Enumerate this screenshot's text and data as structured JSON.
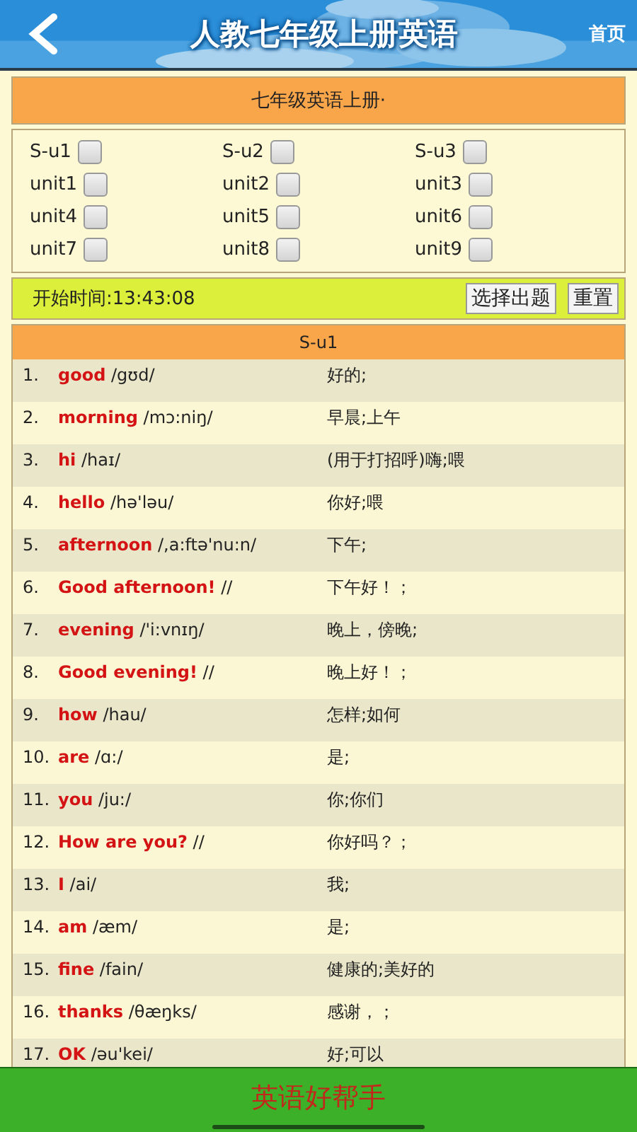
{
  "header": {
    "title": "人教七年级上册英语",
    "home_link": "首页"
  },
  "book_title": "七年级英语上册·",
  "units": [
    {
      "label": "S-u1",
      "checked": false
    },
    {
      "label": "S-u2",
      "checked": false
    },
    {
      "label": "S-u3",
      "checked": false
    },
    {
      "label": "unit1",
      "checked": false
    },
    {
      "label": "unit2",
      "checked": false
    },
    {
      "label": "unit3",
      "checked": false
    },
    {
      "label": "unit4",
      "checked": false
    },
    {
      "label": "unit5",
      "checked": false
    },
    {
      "label": "unit6",
      "checked": false
    },
    {
      "label": "unit7",
      "checked": false
    },
    {
      "label": "unit8",
      "checked": false
    },
    {
      "label": "unit9",
      "checked": false
    }
  ],
  "control_bar": {
    "start_time": "开始时间:13:43:08",
    "buttons": [
      "选择出题",
      "重置"
    ]
  },
  "word_list": {
    "title": "S-u1",
    "rows": [
      {
        "number": "1.",
        "word": "good",
        "phonetic": "/gʊd/",
        "meaning": "好的;"
      },
      {
        "number": "2.",
        "word": "morning",
        "phonetic": "/mɔ:niŋ/",
        "meaning": "早晨;上午"
      },
      {
        "number": "3.",
        "word": "hi",
        "phonetic": "/haɪ/",
        "meaning": "(用于打招呼)嗨;喂"
      },
      {
        "number": "4.",
        "word": "hello",
        "phonetic": "/hə'ləu/",
        "meaning": "你好;喂"
      },
      {
        "number": "5.",
        "word": "afternoon",
        "phonetic": "/,a:ftə'nu:n/",
        "meaning": "下午;"
      },
      {
        "number": "6.",
        "word": "Good afternoon!",
        "phonetic": "//",
        "meaning": "下午好！；"
      },
      {
        "number": "7.",
        "word": "evening",
        "phonetic": "/'i:vnɪŋ/",
        "meaning": "晚上，傍晚;"
      },
      {
        "number": "8.",
        "word": "Good evening!",
        "phonetic": "//",
        "meaning": "晚上好！；"
      },
      {
        "number": "9.",
        "word": "how",
        "phonetic": "/hau/",
        "meaning": "怎样;如何"
      },
      {
        "number": "10.",
        "word": "are",
        "phonetic": "/ɑ:/",
        "meaning": "是;"
      },
      {
        "number": "11.",
        "word": "you",
        "phonetic": "/ju:/",
        "meaning": "你;你们"
      },
      {
        "number": "12.",
        "word": "How are you?",
        "phonetic": "//",
        "meaning": "你好吗？；"
      },
      {
        "number": "13.",
        "word": "I",
        "phonetic": "/ai/",
        "meaning": "我;"
      },
      {
        "number": "14.",
        "word": "am",
        "phonetic": "/æm/",
        "meaning": "是;"
      },
      {
        "number": "15.",
        "word": "fine",
        "phonetic": "/fain/",
        "meaning": "健康的;美好的"
      },
      {
        "number": "16.",
        "word": "thanks",
        "phonetic": "/θæŋks/",
        "meaning": "感谢，；"
      },
      {
        "number": "17.",
        "word": "OK",
        "phonetic": "/əu'kei/",
        "meaning": "好;可以"
      }
    ]
  },
  "footer": {
    "title": "英语好帮手"
  }
}
